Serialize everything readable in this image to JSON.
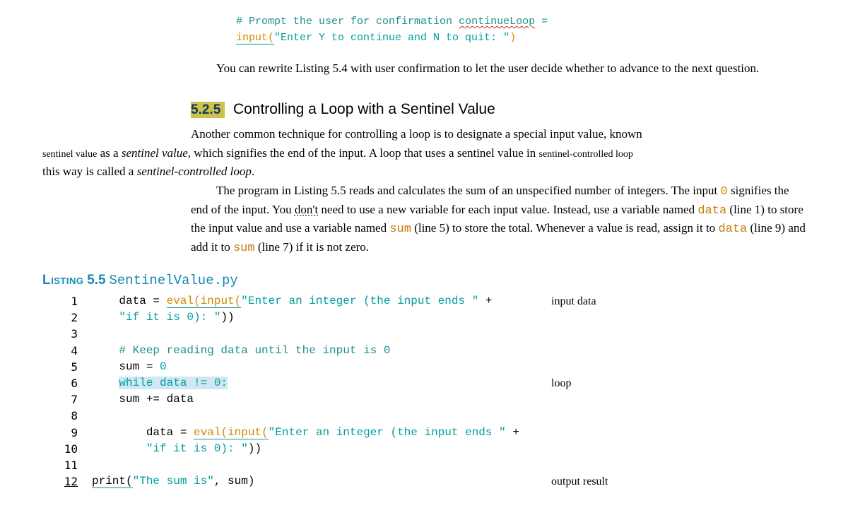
{
  "topCode": {
    "comment": "# Prompt the user for confirmation ",
    "squiggle": "continueLoop",
    "equals": " =",
    "line2_a": "input(",
    "line2_b": "\"Enter Y to continue and N to quit: \"",
    "line2_c": ")"
  },
  "rewriteText": "You can rewrite Listing 5.4 with user confirmation to let the user decide whether to advance to the next question.",
  "section": {
    "number": "5.2.5",
    "title": "Controlling a Loop with a Sentinel Value"
  },
  "body": {
    "p1_a": "Another common technique for controlling a loop is to designate a special input value, known",
    "margin1": "sentinel value",
    "p1_b": "as a ",
    "p1_c": "sentinel value",
    "p1_d": ", which signifies the end of the input. A loop that uses a sentinel value in ",
    "margin2": "sentinel-controlled loop",
    "p1_e": "this way is called a ",
    "p1_f": "sentinel-controlled loop",
    "p1_g": ".",
    "p2_a": "The program in Listing 5.5 reads and calculates the sum of an unspecified number of integers. The input ",
    "p2_zero": "0",
    "p2_b": " signifies the end of the input. You ",
    "p2_dont": "don't",
    "p2_c": " need to use a new variable for each input value. Instead, use a variable named ",
    "p2_data": "data",
    "p2_d": " (line 1) to store the input value and use a variable named ",
    "p2_sum": "sum",
    "p2_e": " (line 5) to store the total. Whenever a value is read, assign it to ",
    "p2_f": " (line 9) and add it to ",
    "p2_g": " (line 7) if it is not zero."
  },
  "listing": {
    "word": "Listing",
    "num": "5.5",
    "file": "SentinelValue.py"
  },
  "code": {
    "l1": {
      "ln": "1",
      "a": "    data = ",
      "b": "eval(input(",
      "c": "\"Enter an integer (the input ends \"",
      "d": " +",
      "annot": "input data"
    },
    "l2": {
      "ln": "2",
      "a": "    ",
      "b": "\"if it is 0): \"",
      "c": "))"
    },
    "l3": {
      "ln": "3",
      "a": ""
    },
    "l4": {
      "ln": "4",
      "a": "    ",
      "b": "# Keep reading data until the input is 0"
    },
    "l5": {
      "ln": "5",
      "a": "    sum = ",
      "b": "0"
    },
    "l6": {
      "ln": "6",
      "a": "    ",
      "b": "while data != 0:",
      "annot": "loop"
    },
    "l7": {
      "ln": "7",
      "a": "    sum += data"
    },
    "l8": {
      "ln": "8",
      "a": ""
    },
    "l9": {
      "ln": "9",
      "a": "        data = ",
      "b": "eval(input(",
      "c": "\"Enter an integer (the input ends \"",
      "d": " +"
    },
    "l10": {
      "ln": "10",
      "a": "        ",
      "b": "\"if it is 0): \"",
      "c": "))"
    },
    "l11": {
      "ln": "11",
      "a": ""
    },
    "l12": {
      "ln": "12",
      "a": "print(",
      "b": "\"The sum is\"",
      "c": ", sum)",
      "annot": "output result"
    }
  }
}
